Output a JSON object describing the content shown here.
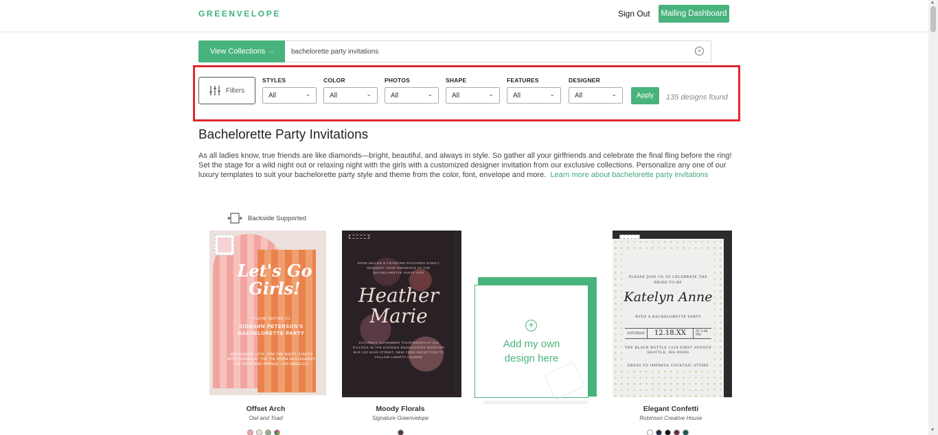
{
  "header": {
    "logo": "GREENVELOPE",
    "sign_out": "Sign Out",
    "mailing_dashboard": "Mailing Dashboard"
  },
  "search": {
    "view_collections": "View Collections",
    "query": "bachelorette party invitations"
  },
  "filters": {
    "button_label": "Filters",
    "groups": [
      {
        "label": "STYLES",
        "value": "All"
      },
      {
        "label": "COLOR",
        "value": "All"
      },
      {
        "label": "PHOTOS",
        "value": "All"
      },
      {
        "label": "SHAPE",
        "value": "All"
      },
      {
        "label": "FEATURES",
        "value": "All"
      },
      {
        "label": "DESIGNER",
        "value": "All"
      }
    ],
    "apply": "Apply",
    "results": "135 designs found"
  },
  "page": {
    "title": "Bachelorette Party Invitations",
    "description": "As all ladies know, true friends are like diamonds—bright, beautiful, and always in style. So gather all your girlfriends and celebrate the final fling before the ring! Set the stage for a wild night out or relaxing night with the girls with a customized designer invitation from our exclusive collections. Personalize any one of our luxury templates to suit your bachelorette party style and theme from the color, font, envelope and more.",
    "learn_more": "Learn more about bachelorette party invitations",
    "backside_supported": "Backside Supported"
  },
  "cards": [
    {
      "name": "Offset Arch",
      "designer": "Owl and Toad",
      "art_script": "Let's Go Girls!",
      "art_small": "YOU'RE INVITED TO",
      "art_name": "SIOBAHN PETERSON'S BACHELORETTE PARTY",
      "art_details": "SEPTEMBER 12TH, 7PM THE NIGHT STARTS WITH DINNER AT THE TIN ROOM RESTAURANT 123 HIGHLAND AVENUE, LOS ANGELES",
      "swatches": [
        "#f4a3a3",
        "#e8ddd4",
        "#8fb07a",
        "#e0a030"
      ]
    },
    {
      "name": "Moody Florals",
      "designer": "Signature Greenvelope",
      "art_top": "ROSE MILLER & FRANCINE RICHARDS KINDLY REQUEST YOUR PRESENCE AT THE BACHELORETTE PARTY FOR",
      "art_script": "Heather Marie",
      "art_bottom": "SATURDAY, NOVEMBER FOURTEENTH AT SIX O'CLOCK IN THE EVENING BOOKLOVERS ROOFTOP BAR 123 MAIN STREET, NEW YORK RECEPTION TO FOLLOW LIBERTY LOUNGE",
      "swatches": [
        "#5a3a40"
      ]
    },
    {
      "add_own": "Add my own design here"
    },
    {
      "name": "Elegant Confetti",
      "designer": "Robinson Creative House",
      "art_top": "PLEASE JOIN US TO CELEBRATE THE BRIDE-TO-BE",
      "art_script": "Katelyn Anne",
      "art_mid": "WITH A BACHELORETTE PARTY",
      "art_day": "SATURDAY",
      "art_date": "12.18.XX",
      "art_time": "AT 5:00 PM",
      "art_venue": "THE BLACK BOTTLE 1234 FIRST AVENUE SEATTLE, WA 98000",
      "art_dress": "DRESS TO IMPRESS COCKTAIL ATTIRE",
      "swatches": [
        "#ffffff",
        "#1c2b4a",
        "#111111",
        "#6b2a4a",
        "#1a5a5a"
      ]
    }
  ],
  "colors": {
    "brand_green": "#48b37c",
    "highlight_red": "#e2262f"
  }
}
